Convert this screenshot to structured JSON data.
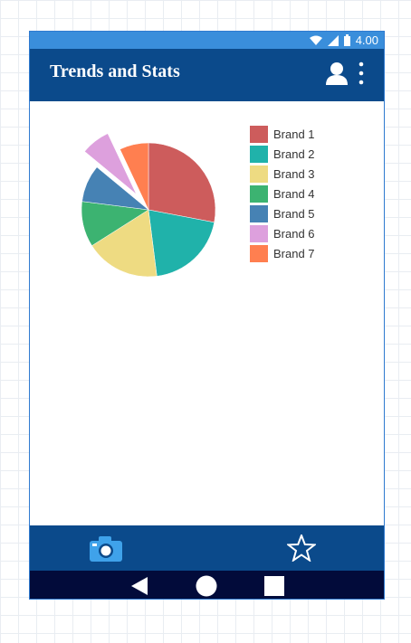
{
  "status_bar": {
    "time": "4.00"
  },
  "app_bar": {
    "title": "Trends and Stats"
  },
  "icons": {
    "status": [
      "wifi-icon",
      "signal-icon",
      "battery-icon"
    ],
    "app_bar": [
      "user-icon",
      "more-vert-icon"
    ],
    "bottom_bar": [
      "camera-icon",
      "star-icon"
    ],
    "nav_bar": [
      "back-icon",
      "home-icon",
      "recent-apps-icon"
    ]
  },
  "colors": {
    "app_bar": "#0b4a8b",
    "status_bar": "#3a8edb",
    "nav_bar": "#020b3a"
  },
  "chart_data": {
    "type": "pie",
    "title": "",
    "start": "top, clockwise",
    "exploded": [
      "Brand 6"
    ],
    "legend_position": "right",
    "categories": [
      "Brand 1",
      "Brand 2",
      "Brand 3",
      "Brand 4",
      "Brand 5",
      "Brand 6",
      "Brand 7"
    ],
    "values": [
      28,
      20,
      18,
      11,
      9,
      7,
      7
    ],
    "colors": [
      "#cd5c5c",
      "#20b2aa",
      "#eedb82",
      "#3cb371",
      "#4682b4",
      "#dda0dd",
      "#ff7f50"
    ]
  }
}
